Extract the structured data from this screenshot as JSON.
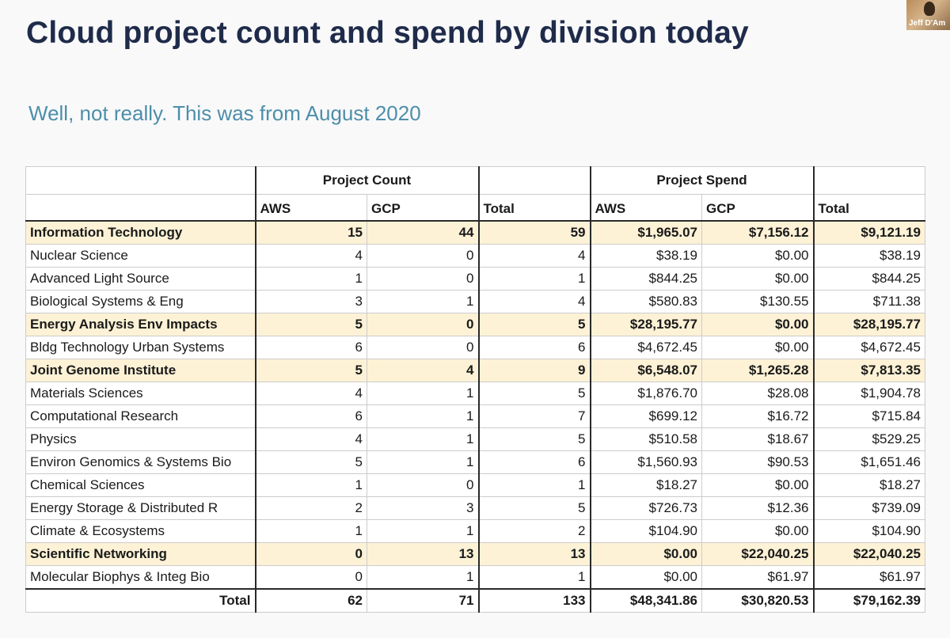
{
  "title": "Cloud project count and spend by division today",
  "subtitle": "Well, not really.  This was from August 2020",
  "webcam": {
    "name": "Jeff D'Am"
  },
  "table": {
    "group_headers": {
      "count": "Project Count",
      "spend": "Project Spend"
    },
    "sub_headers": {
      "aws": "AWS",
      "gcp": "GCP",
      "total": "Total"
    },
    "rows": [
      {
        "division": "Information Technology",
        "aws": "15",
        "gcp": "44",
        "total": "59",
        "aws_spend": "$1,965.07",
        "gcp_spend": "$7,156.12",
        "total_spend": "$9,121.19",
        "highlight": true
      },
      {
        "division": "Nuclear Science",
        "aws": "4",
        "gcp": "0",
        "total": "4",
        "aws_spend": "$38.19",
        "gcp_spend": "$0.00",
        "total_spend": "$38.19",
        "highlight": false
      },
      {
        "division": "Advanced Light Source",
        "aws": "1",
        "gcp": "0",
        "total": "1",
        "aws_spend": "$844.25",
        "gcp_spend": "$0.00",
        "total_spend": "$844.25",
        "highlight": false
      },
      {
        "division": "Biological Systems & Eng",
        "aws": "3",
        "gcp": "1",
        "total": "4",
        "aws_spend": "$580.83",
        "gcp_spend": "$130.55",
        "total_spend": "$711.38",
        "highlight": false
      },
      {
        "division": "Energy Analysis Env Impacts",
        "aws": "5",
        "gcp": "0",
        "total": "5",
        "aws_spend": "$28,195.77",
        "gcp_spend": "$0.00",
        "total_spend": "$28,195.77",
        "highlight": true
      },
      {
        "division": "Bldg Technology Urban Systems",
        "aws": "6",
        "gcp": "0",
        "total": "6",
        "aws_spend": "$4,672.45",
        "gcp_spend": "$0.00",
        "total_spend": "$4,672.45",
        "highlight": false
      },
      {
        "division": "Joint Genome Institute",
        "aws": "5",
        "gcp": "4",
        "total": "9",
        "aws_spend": "$6,548.07",
        "gcp_spend": "$1,265.28",
        "total_spend": "$7,813.35",
        "highlight": true
      },
      {
        "division": "Materials Sciences",
        "aws": "4",
        "gcp": "1",
        "total": "5",
        "aws_spend": "$1,876.70",
        "gcp_spend": "$28.08",
        "total_spend": "$1,904.78",
        "highlight": false
      },
      {
        "division": "Computational Research",
        "aws": "6",
        "gcp": "1",
        "total": "7",
        "aws_spend": "$699.12",
        "gcp_spend": "$16.72",
        "total_spend": "$715.84",
        "highlight": false
      },
      {
        "division": "Physics",
        "aws": "4",
        "gcp": "1",
        "total": "5",
        "aws_spend": "$510.58",
        "gcp_spend": "$18.67",
        "total_spend": "$529.25",
        "highlight": false
      },
      {
        "division": "Environ Genomics & Systems Bio",
        "aws": "5",
        "gcp": "1",
        "total": "6",
        "aws_spend": "$1,560.93",
        "gcp_spend": "$90.53",
        "total_spend": "$1,651.46",
        "highlight": false
      },
      {
        "division": "Chemical Sciences",
        "aws": "1",
        "gcp": "0",
        "total": "1",
        "aws_spend": "$18.27",
        "gcp_spend": "$0.00",
        "total_spend": "$18.27",
        "highlight": false
      },
      {
        "division": "Energy Storage & Distributed R",
        "aws": "2",
        "gcp": "3",
        "total": "5",
        "aws_spend": "$726.73",
        "gcp_spend": "$12.36",
        "total_spend": "$739.09",
        "highlight": false
      },
      {
        "division": "Climate & Ecosystems",
        "aws": "1",
        "gcp": "1",
        "total": "2",
        "aws_spend": "$104.90",
        "gcp_spend": "$0.00",
        "total_spend": "$104.90",
        "highlight": false
      },
      {
        "division": "Scientific Networking",
        "aws": "0",
        "gcp": "13",
        "total": "13",
        "aws_spend": "$0.00",
        "gcp_spend": "$22,040.25",
        "total_spend": "$22,040.25",
        "highlight": true
      },
      {
        "division": "Molecular Biophys & Integ Bio",
        "aws": "0",
        "gcp": "1",
        "total": "1",
        "aws_spend": "$0.00",
        "gcp_spend": "$61.97",
        "total_spend": "$61.97",
        "highlight": false
      }
    ],
    "total_row": {
      "label": "Total",
      "aws": "62",
      "gcp": "71",
      "total": "133",
      "aws_spend": "$48,341.86",
      "gcp_spend": "$30,820.53",
      "total_spend": "$79,162.39"
    }
  }
}
